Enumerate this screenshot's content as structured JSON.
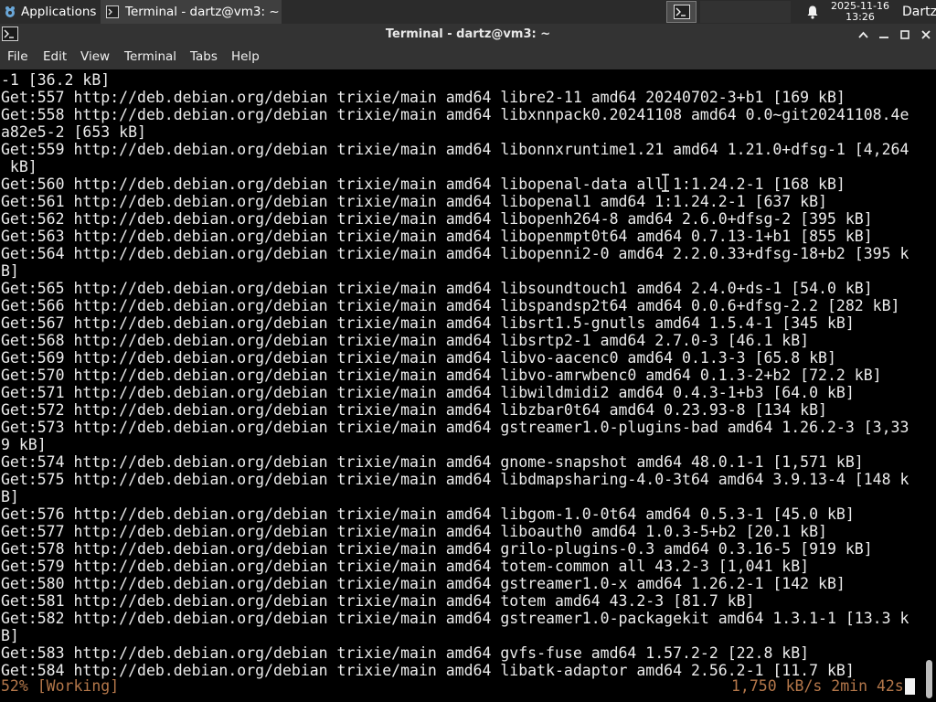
{
  "panel": {
    "applications_label": "Applications",
    "task_title": "Terminal - dartz@vm3: ~",
    "clock_date": "2025-11-16",
    "clock_time": "13:26",
    "user": "Dartz"
  },
  "window": {
    "title": "Terminal - dartz@vm3: ~"
  },
  "menubar": [
    "File",
    "Edit",
    "View",
    "Terminal",
    "Tabs",
    "Help"
  ],
  "terminal": {
    "lines": [
      "-1 [36.2 kB]",
      "Get:557 http://deb.debian.org/debian trixie/main amd64 libre2-11 amd64 20240702-3+b1 [169 kB]",
      "Get:558 http://deb.debian.org/debian trixie/main amd64 libxnnpack0.20241108 amd64 0.0~git20241108.4e",
      "a82e5-2 [653 kB]",
      "Get:559 http://deb.debian.org/debian trixie/main amd64 libonnxruntime1.21 amd64 1.21.0+dfsg-1 [4,264",
      " kB]",
      "Get:560 http://deb.debian.org/debian trixie/main amd64 libopenal-data all 1:1.24.2-1 [168 kB]",
      "Get:561 http://deb.debian.org/debian trixie/main amd64 libopenal1 amd64 1:1.24.2-1 [637 kB]",
      "Get:562 http://deb.debian.org/debian trixie/main amd64 libopenh264-8 amd64 2.6.0+dfsg-2 [395 kB]",
      "Get:563 http://deb.debian.org/debian trixie/main amd64 libopenmpt0t64 amd64 0.7.13-1+b1 [855 kB]",
      "Get:564 http://deb.debian.org/debian trixie/main amd64 libopenni2-0 amd64 2.2.0.33+dfsg-18+b2 [395 k",
      "B]",
      "Get:565 http://deb.debian.org/debian trixie/main amd64 libsoundtouch1 amd64 2.4.0+ds-1 [54.0 kB]",
      "Get:566 http://deb.debian.org/debian trixie/main amd64 libspandsp2t64 amd64 0.0.6+dfsg-2.2 [282 kB]",
      "Get:567 http://deb.debian.org/debian trixie/main amd64 libsrt1.5-gnutls amd64 1.5.4-1 [345 kB]",
      "Get:568 http://deb.debian.org/debian trixie/main amd64 libsrtp2-1 amd64 2.7.0-3 [46.1 kB]",
      "Get:569 http://deb.debian.org/debian trixie/main amd64 libvo-aacenc0 amd64 0.1.3-3 [65.8 kB]",
      "Get:570 http://deb.debian.org/debian trixie/main amd64 libvo-amrwbenc0 amd64 0.1.3-2+b2 [72.2 kB]",
      "Get:571 http://deb.debian.org/debian trixie/main amd64 libwildmidi2 amd64 0.4.3-1+b3 [64.0 kB]",
      "Get:572 http://deb.debian.org/debian trixie/main amd64 libzbar0t64 amd64 0.23.93-8 [134 kB]",
      "Get:573 http://deb.debian.org/debian trixie/main amd64 gstreamer1.0-plugins-bad amd64 1.26.2-3 [3,33",
      "9 kB]",
      "Get:574 http://deb.debian.org/debian trixie/main amd64 gnome-snapshot amd64 48.0.1-1 [1,571 kB]",
      "Get:575 http://deb.debian.org/debian trixie/main amd64 libdmapsharing-4.0-3t64 amd64 3.9.13-4 [148 k",
      "B]",
      "Get:576 http://deb.debian.org/debian trixie/main amd64 libgom-1.0-0t64 amd64 0.5.3-1 [45.0 kB]",
      "Get:577 http://deb.debian.org/debian trixie/main amd64 liboauth0 amd64 1.0.3-5+b2 [20.1 kB]",
      "Get:578 http://deb.debian.org/debian trixie/main amd64 grilo-plugins-0.3 amd64 0.3.16-5 [919 kB]",
      "Get:579 http://deb.debian.org/debian trixie/main amd64 totem-common all 43.2-3 [1,041 kB]",
      "Get:580 http://deb.debian.org/debian trixie/main amd64 gstreamer1.0-x amd64 1.26.2-1 [142 kB]",
      "Get:581 http://deb.debian.org/debian trixie/main amd64 totem amd64 43.2-3 [81.7 kB]",
      "Get:582 http://deb.debian.org/debian trixie/main amd64 gstreamer1.0-packagekit amd64 1.3.1-1 [13.3 k",
      "B]",
      "Get:583 http://deb.debian.org/debian trixie/main amd64 gvfs-fuse amd64 1.57.2-2 [22.8 kB]",
      "Get:584 http://deb.debian.org/debian trixie/main amd64 libatk-adaptor amd64 2.56.2-1 [11.7 kB]"
    ],
    "status_left": "52% [Working]",
    "status_right": "1,750 kB/s 2min 42s"
  },
  "colors": {
    "terminal_bg": "#000000",
    "terminal_fg": "#ececec",
    "status_fg": "#b4774a",
    "chrome_bg": "#333333"
  },
  "icons": [
    "xfce-mouse-icon",
    "terminal-icon",
    "workspace-terminal-icon",
    "bell-icon",
    "window-up-icon",
    "minimize-icon",
    "maximize-icon",
    "close-icon",
    "ibeam-cursor-icon"
  ]
}
